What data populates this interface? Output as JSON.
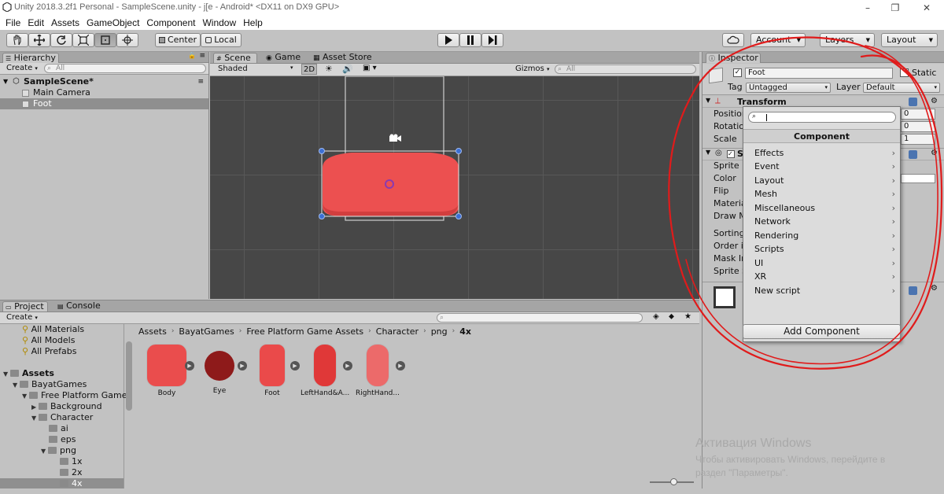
{
  "window": {
    "title": "Unity 2018.3.2f1 Personal - SampleScene.unity - j[e - Android* <DX11 on DX9 GPU>",
    "controls": [
      "–",
      "❐",
      "✕"
    ]
  },
  "menu": [
    "File",
    "Edit",
    "Assets",
    "GameObject",
    "Component",
    "Window",
    "Help"
  ],
  "toolbar": {
    "pivot_label": "Center",
    "space_label": "Local",
    "account_label": "Account",
    "layers_label": "Layers",
    "layout_label": "Layout"
  },
  "hierarchy": {
    "tab": "Hierarchy",
    "create_label": "Create",
    "search_placeholder": "All",
    "scene_name": "SampleScene*",
    "items": [
      "Main Camera",
      "Foot"
    ]
  },
  "scene": {
    "tabs": [
      "Scene",
      "Game",
      "Asset Store"
    ],
    "shading": "Shaded",
    "mode_2d": "2D",
    "gizmos_label": "Gizmos",
    "search_placeholder": "All"
  },
  "inspector": {
    "tab": "Inspector",
    "object_name": "Foot",
    "static_label": "Static",
    "tag_label": "Tag",
    "tag_value": "Untagged",
    "layer_label": "Layer",
    "layer_value": "Default",
    "transform_label": "Transform",
    "position_label": "Position",
    "rotation_label": "Rotation",
    "scale_label": "Scale",
    "position_z": "0",
    "rotation_z": "0",
    "scale_z": "1",
    "sr_label_fragment": "S",
    "sprite_label": "Sprite",
    "color_label": "Color",
    "flip_label": "Flip",
    "material_label": "Materia",
    "drawmode_label": "Draw M",
    "sorting_label": "Sorting",
    "order_label": "Order ir",
    "mask_label": "Mask Ir",
    "spritesort_label": "Sprite S",
    "add_component_label": "Add Component"
  },
  "component_popup": {
    "header": "Component",
    "search_value": "",
    "items": [
      "Effects",
      "Event",
      "Layout",
      "Mesh",
      "Miscellaneous",
      "Network",
      "Rendering",
      "Scripts",
      "UI",
      "XR",
      "New script"
    ]
  },
  "project": {
    "tabs": [
      "Project",
      "Console"
    ],
    "create_label": "Create",
    "favorites": [
      "All Materials",
      "All Models",
      "All Prefabs"
    ],
    "tree": [
      {
        "label": "Assets",
        "depth": 0,
        "bold": true
      },
      {
        "label": "BayatGames",
        "depth": 1
      },
      {
        "label": "Free Platform Game",
        "depth": 2
      },
      {
        "label": "Background",
        "depth": 3
      },
      {
        "label": "Character",
        "depth": 3
      },
      {
        "label": "ai",
        "depth": 4
      },
      {
        "label": "eps",
        "depth": 4
      },
      {
        "label": "png",
        "depth": 4
      },
      {
        "label": "1x",
        "depth": 5
      },
      {
        "label": "2x",
        "depth": 5
      },
      {
        "label": "4x",
        "depth": 5
      }
    ],
    "breadcrumb": [
      "Assets",
      "BayatGames",
      "Free Platform Game Assets",
      "Character",
      "png",
      "4x"
    ],
    "assets": [
      {
        "name": "Body",
        "color": "#ea4d4d"
      },
      {
        "name": "Eye",
        "color": "#8e1a1a"
      },
      {
        "name": "Foot",
        "color": "#ea4a4a"
      },
      {
        "name": "LeftHand&A...",
        "color": "#e03838"
      },
      {
        "name": "RightHand...",
        "color": "#ec6a6a"
      }
    ]
  },
  "watermark": {
    "title": "Активация Windows",
    "line1": "Чтобы активировать Windows, перейдите в",
    "line2": "раздел \"Параметры\"."
  },
  "colors": {
    "annotation": "#e01b1b",
    "sprite": "#ec5050",
    "selection": "#8f8f8f"
  }
}
